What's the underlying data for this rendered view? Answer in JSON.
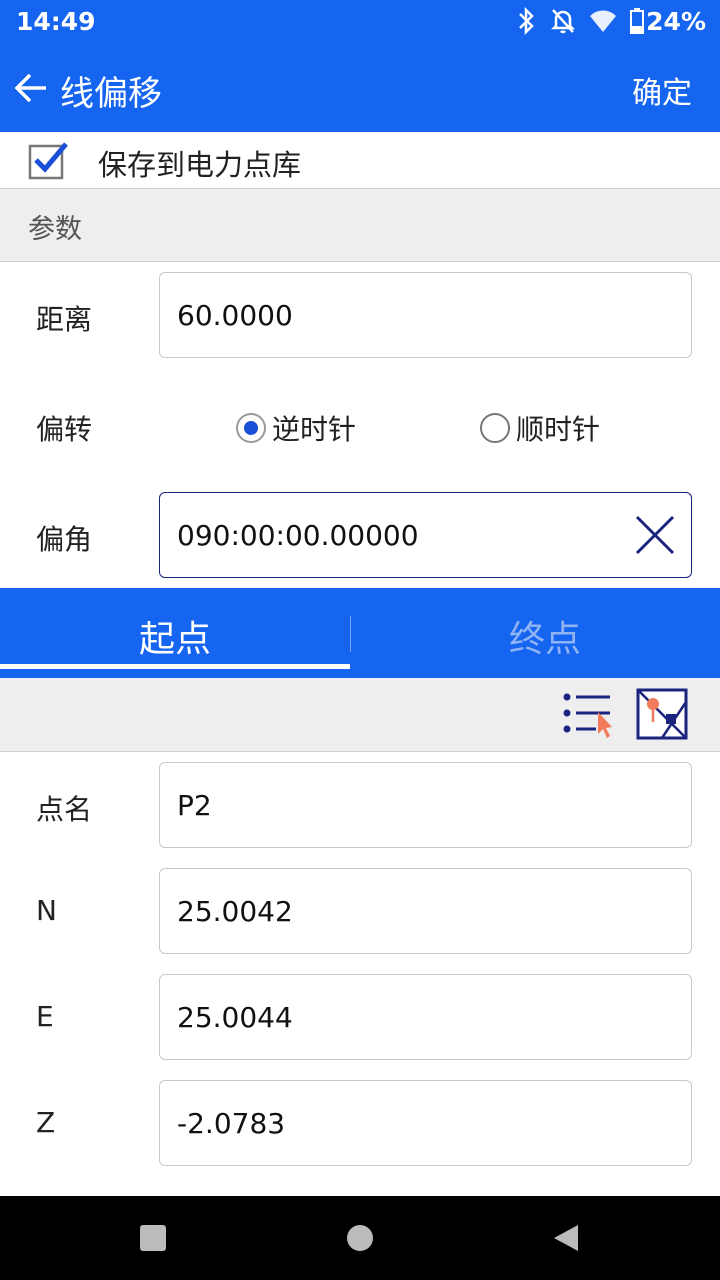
{
  "status_bar": {
    "time": "14:49",
    "battery": "24%",
    "icons": [
      "bluetooth-icon",
      "bell-off-icon",
      "wifi-icon",
      "battery-icon"
    ]
  },
  "app_bar": {
    "title": "线偏移",
    "confirm_label": "确定",
    "back_icon": "arrow-left-icon"
  },
  "save_option": {
    "label": "保存到电力点库",
    "checked": true
  },
  "params_section": {
    "title": "参数",
    "distance": {
      "label": "距离",
      "value": "60.0000"
    },
    "direction": {
      "label": "偏转",
      "options": [
        {
          "label": "逆时针",
          "selected": true
        },
        {
          "label": "顺时针",
          "selected": false
        }
      ]
    },
    "angle": {
      "label": "偏角",
      "value": "090:00:00.00000"
    }
  },
  "tabs": [
    {
      "label": "起点",
      "active": true
    },
    {
      "label": "终点",
      "active": false
    }
  ],
  "point": {
    "name": {
      "label": "点名",
      "value": "P2"
    },
    "n": {
      "label": "N",
      "value": "25.0042"
    },
    "e": {
      "label": "E",
      "value": "25.0044"
    },
    "z": {
      "label": "Z",
      "value": "-2.0783"
    }
  },
  "colors": {
    "primary": "#1565f0",
    "accent_dark": "#1a237e",
    "tab_inactive": "#8fb3f5",
    "section_bg": "#eeeeee"
  }
}
